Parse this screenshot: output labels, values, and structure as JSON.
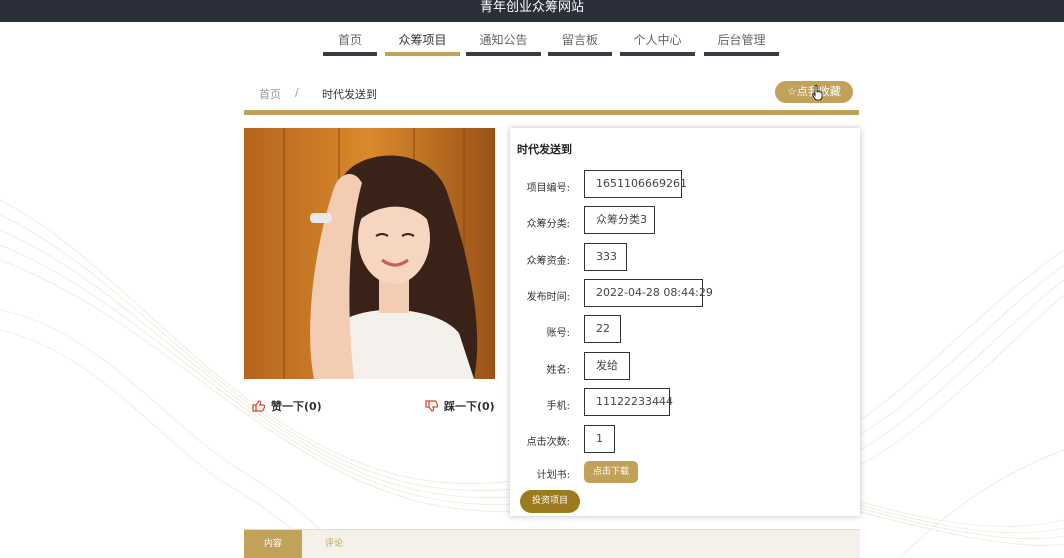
{
  "site": {
    "title": "青年创业众筹网站"
  },
  "nav": {
    "items": [
      {
        "label": "首页"
      },
      {
        "label": "众筹项目"
      },
      {
        "label": "通知公告"
      },
      {
        "label": "留言板"
      },
      {
        "label": "个人中心"
      },
      {
        "label": "后台管理"
      }
    ],
    "active": "众筹项目"
  },
  "breadcrumb": {
    "home": "首页",
    "sep": "/",
    "current": "时代发送到"
  },
  "favorite_button": {
    "label": "☆点我收藏"
  },
  "votes": {
    "like_label": "赞一下(0)",
    "dislike_label": "踩一下(0)"
  },
  "detail": {
    "title": "时代发送到",
    "fields": [
      {
        "label": "项目编号:",
        "value": "1651106669261"
      },
      {
        "label": "众筹分类:",
        "value": "众筹分类3"
      },
      {
        "label": "众筹资金:",
        "value": "333"
      },
      {
        "label": "发布时间:",
        "value": "2022-04-28 08:44:29"
      },
      {
        "label": "账号:",
        "value": "22"
      },
      {
        "label": "姓名:",
        "value": "发给"
      },
      {
        "label": "手机:",
        "value": "11122233444"
      },
      {
        "label": "点击次数:",
        "value": "1"
      }
    ],
    "plan_label": "计划书:",
    "download_label": "点击下载",
    "invest_label": "投资项目"
  },
  "tabs": [
    {
      "label": "内容"
    },
    {
      "label": "评论"
    }
  ],
  "colors": {
    "accent": "#c2a25b",
    "topbar": "#2b2f3a",
    "invest": "#9c7a1e"
  },
  "icons": {
    "like": "thumbs-up-icon",
    "dislike": "thumbs-down-icon",
    "cursor": "hand-pointer-icon"
  }
}
